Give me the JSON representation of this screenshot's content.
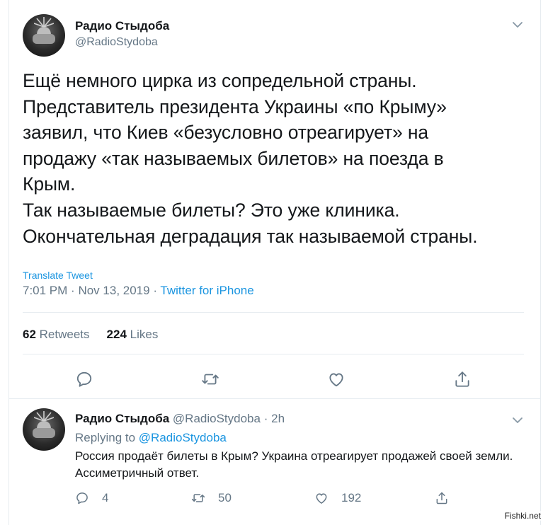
{
  "tweet": {
    "author_name": "Радио Стыдоба",
    "author_handle": "@RadioStydoba",
    "text": "Ещё немного цирка из сопредельной страны.\nПредставитель президента Украины «по Крыму»\nзаявил, что Киев «безусловно отреагирует» на\nпродажу «так называемых билетов» на поезда в\nКрым.\nТак называемые билеты? Это уже клиника.\nОкончательная деградация так называемой страны.",
    "translate_label": "Translate Tweet",
    "time": "7:01 PM",
    "date": "Nov 13, 2019",
    "separator": "·",
    "source": "Twitter for iPhone",
    "retweets_count": "62",
    "retweets_label": "Retweets",
    "likes_count": "224",
    "likes_label": "Likes"
  },
  "reply": {
    "author_name": "Радио Стыдоба",
    "author_handle": "@RadioStydoba",
    "separator": "·",
    "age": "2h",
    "replying_prefix": "Replying to",
    "replying_to": "@RadioStydoba",
    "text": "Россия продаёт билеты в Крым? Украина отреагирует продажей своей земли. Ассиметричный ответ.",
    "replies_count": "4",
    "retweets_count": "50",
    "likes_count": "192"
  },
  "watermark": "Fishki.net",
  "colors": {
    "link": "#1b95e0",
    "secondary": "#657786",
    "primary": "#14171a",
    "divider": "#e6ecf0"
  },
  "icons": [
    "chevron-down-icon",
    "reply-icon",
    "retweet-icon",
    "like-icon",
    "share-icon"
  ]
}
